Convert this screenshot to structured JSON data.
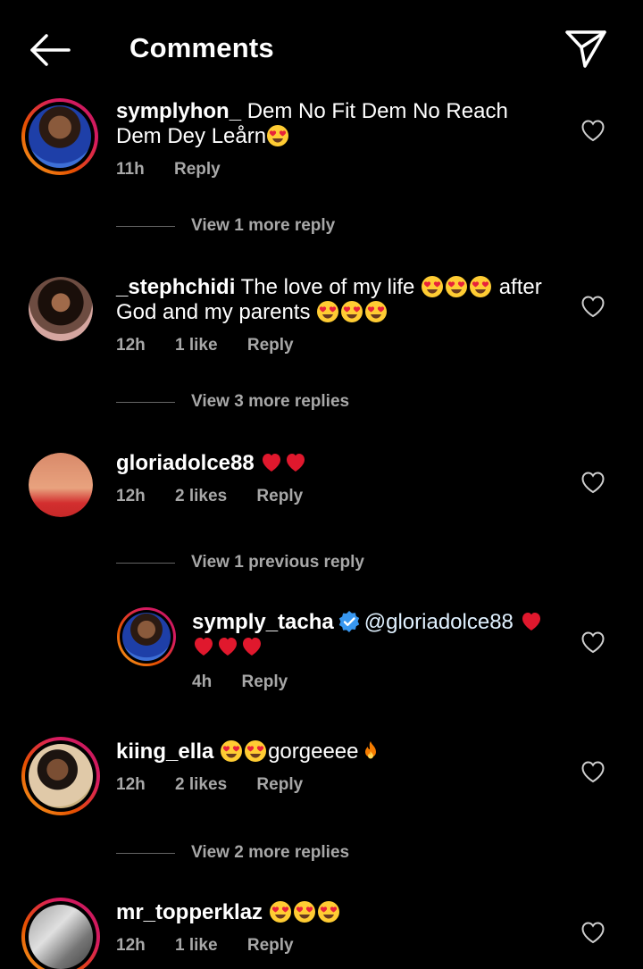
{
  "header": {
    "title": "Comments"
  },
  "comments": [
    {
      "username": "symplyhon_",
      "text": "Dem No Fit Dem No Reach Dem Dey Leårn",
      "emojis": [
        "heart-eyes"
      ],
      "time": "11h",
      "likes": "",
      "reply_label": "Reply",
      "view_more": "View 1 more reply"
    },
    {
      "username": "_stephchidi",
      "text_a": "The love of my life",
      "emojis_a": [
        "heart-eyes",
        "heart-eyes",
        "heart-eyes"
      ],
      "text_b": "after God and my parents",
      "emojis_b": [
        "heart-eyes",
        "heart-eyes",
        "heart-eyes"
      ],
      "time": "12h",
      "likes": "1 like",
      "reply_label": "Reply",
      "view_more": "View 3 more replies"
    },
    {
      "username": "gloriadolce88",
      "emojis": [
        "red-heart",
        "red-heart"
      ],
      "time": "12h",
      "likes": "2 likes",
      "reply_label": "Reply",
      "view_more": "View 1 previous reply"
    },
    {
      "username": "symply_tacha",
      "verified": true,
      "mention": "@gloriadolce88",
      "emojis": [
        "red-heart",
        "red-heart",
        "red-heart",
        "red-heart"
      ],
      "time": "4h",
      "reply_label": "Reply"
    },
    {
      "username": "kiing_ella",
      "text": "gorgeeee",
      "emojis_before": [
        "heart-eyes",
        "heart-eyes"
      ],
      "emojis_after": [
        "fire"
      ],
      "time": "12h",
      "likes": "2 likes",
      "reply_label": "Reply",
      "view_more": "View 2 more replies"
    },
    {
      "username": "mr_topperklaz",
      "emojis": [
        "heart-eyes",
        "heart-eyes",
        "heart-eyes"
      ],
      "time": "12h",
      "likes": "1 like",
      "reply_label": "Reply"
    }
  ],
  "colors": {
    "background": "#000000",
    "text": "#ffffff",
    "meta": "#a8a8a8",
    "story_ring": "#e65100",
    "verified": "#3897f0",
    "heart_red": "#e0182d"
  }
}
